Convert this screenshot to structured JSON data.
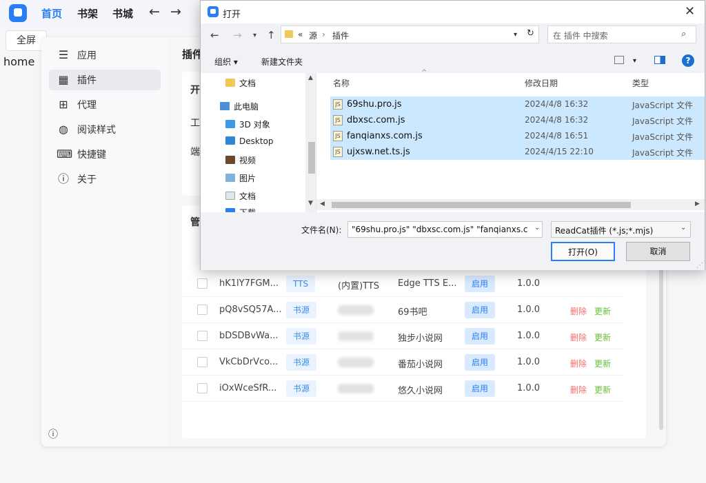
{
  "topbar": {
    "nav": [
      "首页",
      "书架",
      "书城"
    ],
    "back": "←",
    "forward": "→"
  },
  "fullscreen": "全屏",
  "home_label": "home",
  "side_nav": [
    {
      "icon": "sliders-icon",
      "label": "应用"
    },
    {
      "icon": "grid-icon",
      "label": "插件"
    },
    {
      "icon": "network-icon",
      "label": "代理"
    },
    {
      "icon": "palette-icon",
      "label": "阅读样式"
    },
    {
      "icon": "keyboard-icon",
      "label": "快捷键"
    },
    {
      "icon": "info-icon",
      "label": "关于"
    }
  ],
  "content": {
    "title_partial": "插件",
    "card1_fragments": [
      "开",
      "工",
      "端"
    ],
    "card2_fragment": "管"
  },
  "plugin_rows": [
    {
      "id": "hK1lY7FGM...",
      "type": "TTS",
      "author": "(内置)TTS",
      "name": "Edge TTS E...",
      "state": "启用",
      "version": "1.0.0",
      "delete": "",
      "update": ""
    },
    {
      "id": "pQ8vSQ57A...",
      "type": "书源",
      "author": "",
      "name": "69书吧",
      "state": "启用",
      "version": "1.0.0",
      "delete": "删除",
      "update": "更新"
    },
    {
      "id": "bDSDBvWa...",
      "type": "书源",
      "author": "",
      "name": "独步小说网",
      "state": "启用",
      "version": "1.0.0",
      "delete": "删除",
      "update": "更新"
    },
    {
      "id": "VkCbDrVco...",
      "type": "书源",
      "author": "",
      "name": "番茄小说网",
      "state": "启用",
      "version": "1.0.0",
      "delete": "删除",
      "update": "更新"
    },
    {
      "id": "iOxWceSfR...",
      "type": "书源",
      "author": "",
      "name": "悠久小说网",
      "state": "启用",
      "version": "1.0.0",
      "delete": "删除",
      "update": "更新"
    }
  ],
  "dialog": {
    "title": "打开",
    "close": "✕",
    "address": {
      "prefix": "«",
      "crumbs": [
        "源",
        "插件"
      ],
      "sep": "›"
    },
    "search_placeholder": "在 插件 中搜索",
    "toolbar": {
      "organize": "组织 ▾",
      "new_folder": "新建文件夹",
      "help": "?"
    },
    "tree": [
      {
        "label": "文档",
        "icon": "folder"
      },
      {
        "label": "此电脑",
        "icon": "computer"
      },
      {
        "label": "3D 对象",
        "icon": "cube"
      },
      {
        "label": "Desktop",
        "icon": "desktop"
      },
      {
        "label": "视频",
        "icon": "video"
      },
      {
        "label": "图片",
        "icon": "image"
      },
      {
        "label": "文档",
        "icon": "document"
      },
      {
        "label": "下载",
        "icon": "download"
      }
    ],
    "columns": {
      "name": "名称",
      "date": "修改日期",
      "type": "类型"
    },
    "files": [
      {
        "name": "69shu.pro.js",
        "date": "2024/4/8 16:32",
        "type": "JavaScript 文件"
      },
      {
        "name": "dbxsc.com.js",
        "date": "2024/4/8 16:32",
        "type": "JavaScript 文件"
      },
      {
        "name": "fanqianxs.com.js",
        "date": "2024/4/8 16:51",
        "type": "JavaScript 文件"
      },
      {
        "name": "ujxsw.net.ts.js",
        "date": "2024/4/15 22:10",
        "type": "JavaScript 文件"
      }
    ],
    "filename_label": "文件名(N):",
    "filename_value": "\"69shu.pro.js\" \"dbxsc.com.js\" \"fanqianxs.c",
    "filter": "ReadCat插件 (*.js;*.mjs)",
    "open_button": "打开(O)",
    "cancel_button": "取消"
  },
  "colors": {
    "accent": "#2a7ef5",
    "selection": "#cce8ff",
    "delete": "#f56c6c",
    "update": "#67c23a"
  }
}
